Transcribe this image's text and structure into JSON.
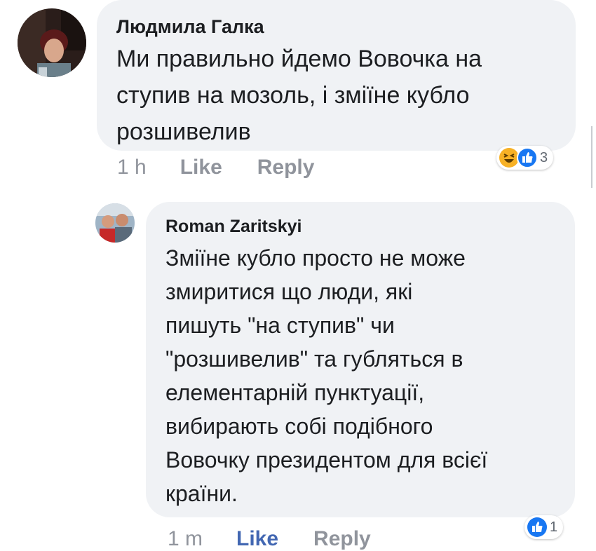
{
  "comments": [
    {
      "author": "Людмила Галка",
      "text": "Ми правильно йдемо Вовочка на\nступив  на мозоль, і зміїне кубло\nрозшивелив",
      "time": "1 h",
      "like_label": "Like",
      "reply_label": "Reply",
      "reactions": [
        "haha-icon",
        "like-icon"
      ],
      "reaction_count": "3"
    },
    {
      "author": "Roman Zaritskyi",
      "text": "Зміїне кубло просто не може\nзмиритися що люди, які\nпишуть \"на ступив\" чи\n\"розшивелив\"  та губляться в\nелементарній пунктуації,\nвибирають собі подібного\nВовочку президентом для всієї\nкраїни.",
      "time": "1 m",
      "like_label": "Like",
      "reply_label": "Reply",
      "reactions": [
        "like-icon"
      ],
      "reaction_count": "1"
    }
  ],
  "colors": {
    "bubble": "#f0f2f5",
    "meta_gray": "#90949c",
    "like_active": "#4267b2",
    "like_reaction": "#1877f2",
    "haha_reaction": "#f7b125"
  }
}
